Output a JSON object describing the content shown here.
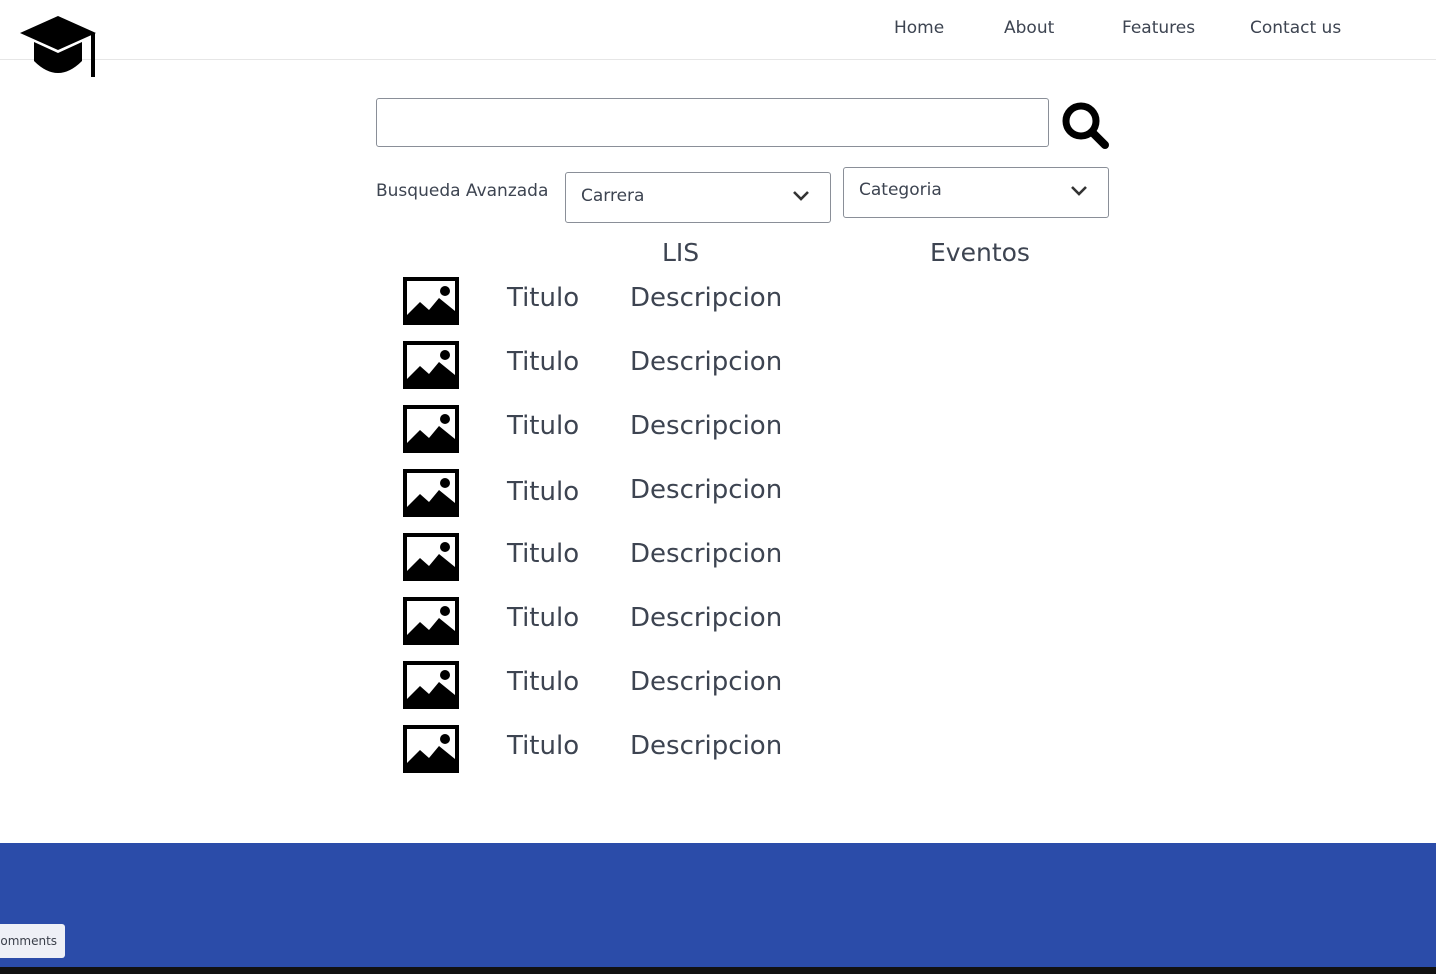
{
  "nav": {
    "logo_icon": "graduation-cap-icon",
    "links": [
      "Home",
      "About",
      "Features",
      "Contact us"
    ]
  },
  "search": {
    "value": "",
    "button_icon": "search-icon"
  },
  "filters": {
    "advanced_label": "Busqueda Avanzada",
    "carrera": "Carrera",
    "categoria": "Categoria"
  },
  "headings": {
    "left": "LIS",
    "right": "Eventos"
  },
  "items": [
    {
      "icon": "image-icon",
      "title": "Titulo",
      "description": "Descripcion"
    },
    {
      "icon": "image-icon",
      "title": "Titulo",
      "description": "Descripcion"
    },
    {
      "icon": "image-icon",
      "title": "Titulo",
      "description": "Descripcion"
    },
    {
      "icon": "image-icon",
      "title": "Titulo",
      "description": "Descripcion"
    },
    {
      "icon": "image-icon",
      "title": "Titulo",
      "description": "Descripcion"
    },
    {
      "icon": "image-icon",
      "title": "Titulo",
      "description": "Descripcion"
    },
    {
      "icon": "image-icon",
      "title": "Titulo",
      "description": "Descripcion"
    },
    {
      "icon": "image-icon",
      "title": "Titulo",
      "description": "Descripcion"
    }
  ],
  "footer": {
    "color": "#2b4ca9",
    "comments_label": "Comments"
  }
}
